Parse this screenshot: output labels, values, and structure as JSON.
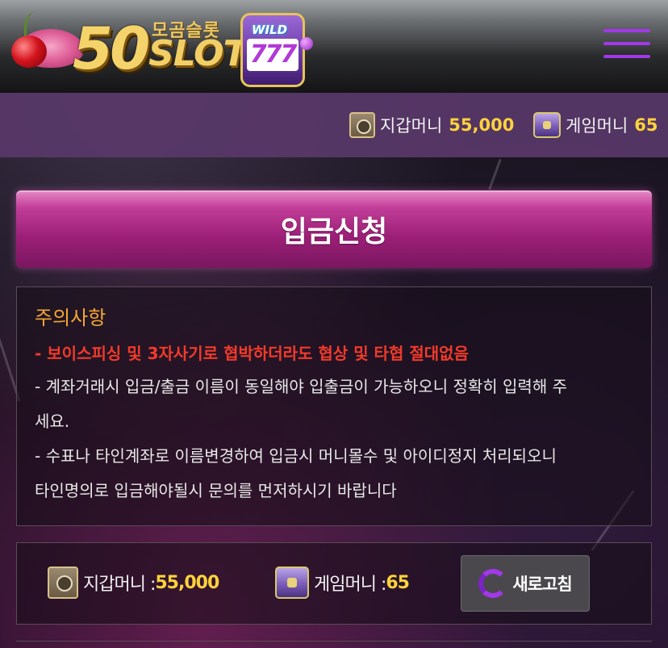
{
  "logo": {
    "number": "50",
    "korean_name": "모곰슬롯",
    "word": "SLOT",
    "machine_badge": "WILD",
    "machine_reels": "777"
  },
  "header": {
    "menu_icon": "hamburger-menu-icon"
  },
  "money_bar": {
    "wallet_label": "지갑머니",
    "wallet_value": "55,000",
    "game_label": "게임머니",
    "game_value": "65"
  },
  "page": {
    "title": "입금신청"
  },
  "notice": {
    "title": "주의사항",
    "warning": "- 보이스피싱 및 3자사기로 협박하더라도 협상 및 타협 절대없음",
    "lines": [
      "- 계좌거래시 입금/출금 이름이 동일해야 입출금이 가능하오니 정확히 입력해 주",
      "세요.",
      "- 수표나 타인계좌로 이름변경하여 입금시 머니몰수 및 아이디정지 처리되오니",
      "타인명의로 입금해야될시 문의를 먼저하시기 바랍니다"
    ]
  },
  "money_box": {
    "wallet_label": "지갑머니 : ",
    "wallet_value": "55,000",
    "game_label": "게임머니 : ",
    "game_value": "65",
    "refresh_label": "새로고침"
  },
  "colors": {
    "accent_purple": "#a238e8",
    "title_pink": "#c23e98",
    "money_yellow": "#ffd23c",
    "notice_orange": "#f4a733",
    "warning_red": "#f23a2a"
  }
}
